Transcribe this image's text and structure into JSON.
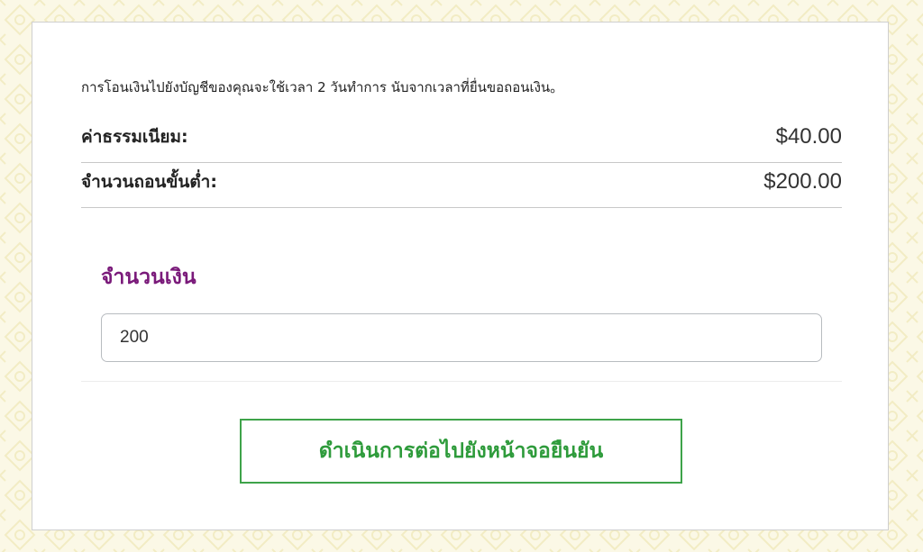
{
  "colors": {
    "page_background": "#fbf8e6",
    "card_background": "#ffffff",
    "accent_purple": "#7a1a7a",
    "accent_green": "#2e9b3b"
  },
  "info_text": "การโอนเงินไปยังบัญชีของคุณจะใช้เวลา 2 วันทำการ นับจากเวลาที่ยื่นขอถอนเงิน。",
  "fee": {
    "label": "ค่าธรรมเนียม:",
    "value": "$40.00"
  },
  "minimum": {
    "label": "จำนวนถอนขั้นต่ำ:",
    "value": "$200.00"
  },
  "amount": {
    "label": "จำนวนเงิน",
    "value": "200"
  },
  "continue_button": {
    "label": "ดำเนินการต่อไปยังหน้าจอยืนยัน"
  }
}
